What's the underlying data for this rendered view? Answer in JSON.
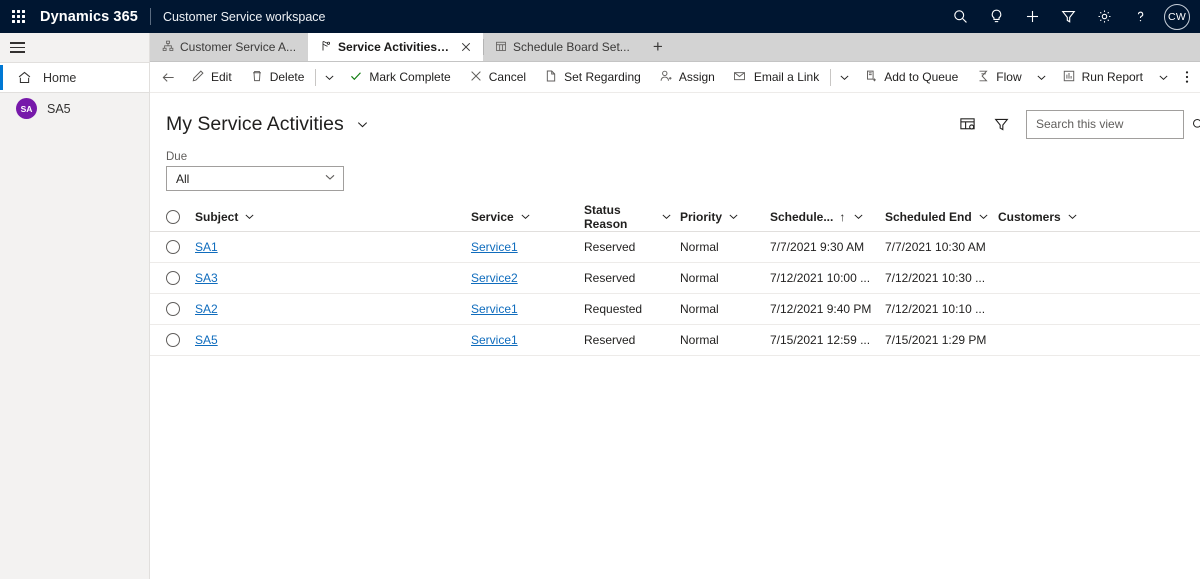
{
  "colors": {
    "header_bg": "#001631",
    "accent": "#0078d4",
    "link": "#0f6cbd",
    "avatar_top_bg": "#001631",
    "avatar_side_bg": "#7719aa",
    "tabstrip_bg": "#d3d3d3"
  },
  "topnav": {
    "waffle_icon": "app-launcher-icon",
    "brand": "Dynamics 365",
    "app_name": "Customer Service workspace",
    "icons": [
      {
        "name": "search-icon",
        "glyph": "search"
      },
      {
        "name": "lightbulb-icon",
        "glyph": "bulb"
      },
      {
        "name": "add-icon",
        "glyph": "plus"
      },
      {
        "name": "filter-icon",
        "glyph": "funnel"
      },
      {
        "name": "settings-icon",
        "glyph": "gear"
      },
      {
        "name": "help-icon",
        "glyph": "question"
      }
    ],
    "avatar_initials": "CW"
  },
  "tabs": [
    {
      "label": "Customer Service A...",
      "icon": "sitemap-icon",
      "active": false,
      "closable": false
    },
    {
      "label": "Service Activities My Ser...",
      "icon": "service-activity-icon",
      "active": true,
      "closable": true
    },
    {
      "label": "Schedule Board Set...",
      "icon": "calendar-icon",
      "active": false,
      "closable": false
    }
  ],
  "tab_add_label": "+",
  "sidebar": {
    "hamburger_label": "Site Map",
    "items": [
      {
        "label": "Home",
        "icon": "home-icon",
        "selected": true,
        "avatar": null
      },
      {
        "label": "SA5",
        "icon": null,
        "selected": false,
        "avatar": "SA"
      }
    ]
  },
  "commandbar": {
    "back_label": "Back",
    "items": [
      {
        "label": "Edit",
        "icon": "pencil-icon",
        "caret": false
      },
      {
        "label": "Delete",
        "icon": "trash-icon",
        "caret": true,
        "divider_before_caret": true
      },
      {
        "label": "Mark Complete",
        "icon": "checkmark-icon",
        "caret": false
      },
      {
        "label": "Cancel",
        "icon": "cancel-x-icon",
        "caret": false
      },
      {
        "label": "Set Regarding",
        "icon": "document-icon",
        "caret": false
      },
      {
        "label": "Assign",
        "icon": "person-add-icon",
        "caret": false
      },
      {
        "label": "Email a Link",
        "icon": "email-link-icon",
        "caret": true,
        "divider_before_caret": true
      },
      {
        "label": "Add to Queue",
        "icon": "add-queue-icon",
        "caret": false
      },
      {
        "label": "Flow",
        "icon": "flow-icon",
        "caret": true
      },
      {
        "label": "Run Report",
        "icon": "report-icon",
        "caret": true
      }
    ],
    "overflow_label": "More commands"
  },
  "view": {
    "title": "My Service Activities",
    "title_caret_icon": "chevron-down-icon",
    "edit_columns_icon": "edit-columns-icon",
    "filter_icon": "filter-icon",
    "search_placeholder": "Search this view",
    "search_value": "",
    "search_icon": "search-icon"
  },
  "due_filter": {
    "label": "Due",
    "value": "All",
    "caret_icon": "chevron-down-icon"
  },
  "grid": {
    "select_all_name": "select-all-checkbox",
    "columns": [
      {
        "key": "subject",
        "label": "Subject",
        "sorted": false
      },
      {
        "key": "service",
        "label": "Service",
        "sorted": false
      },
      {
        "key": "status",
        "label": "Status Reason",
        "sorted": false
      },
      {
        "key": "priority",
        "label": "Priority",
        "sorted": false
      },
      {
        "key": "start",
        "label": "Schedule...",
        "sorted": true,
        "sort_dir": "↑"
      },
      {
        "key": "end",
        "label": "Scheduled End",
        "sorted": false
      },
      {
        "key": "customers",
        "label": "Customers",
        "sorted": false
      }
    ],
    "rows": [
      {
        "subject": "SA1",
        "service": "Service1",
        "status": "Reserved",
        "priority": "Normal",
        "start": "7/7/2021 9:30 AM",
        "end": "7/7/2021 10:30 AM",
        "customers": ""
      },
      {
        "subject": "SA3",
        "service": "Service2",
        "status": "Reserved",
        "priority": "Normal",
        "start": "7/12/2021 10:00 ...",
        "end": "7/12/2021 10:30 ...",
        "customers": ""
      },
      {
        "subject": "SA2",
        "service": "Service1",
        "status": "Requested",
        "priority": "Normal",
        "start": "7/12/2021 9:40 PM",
        "end": "7/12/2021 10:10 ...",
        "customers": ""
      },
      {
        "subject": "SA5",
        "service": "Service1",
        "status": "Reserved",
        "priority": "Normal",
        "start": "7/15/2021 12:59 ...",
        "end": "7/15/2021 1:29 PM",
        "customers": ""
      }
    ]
  }
}
